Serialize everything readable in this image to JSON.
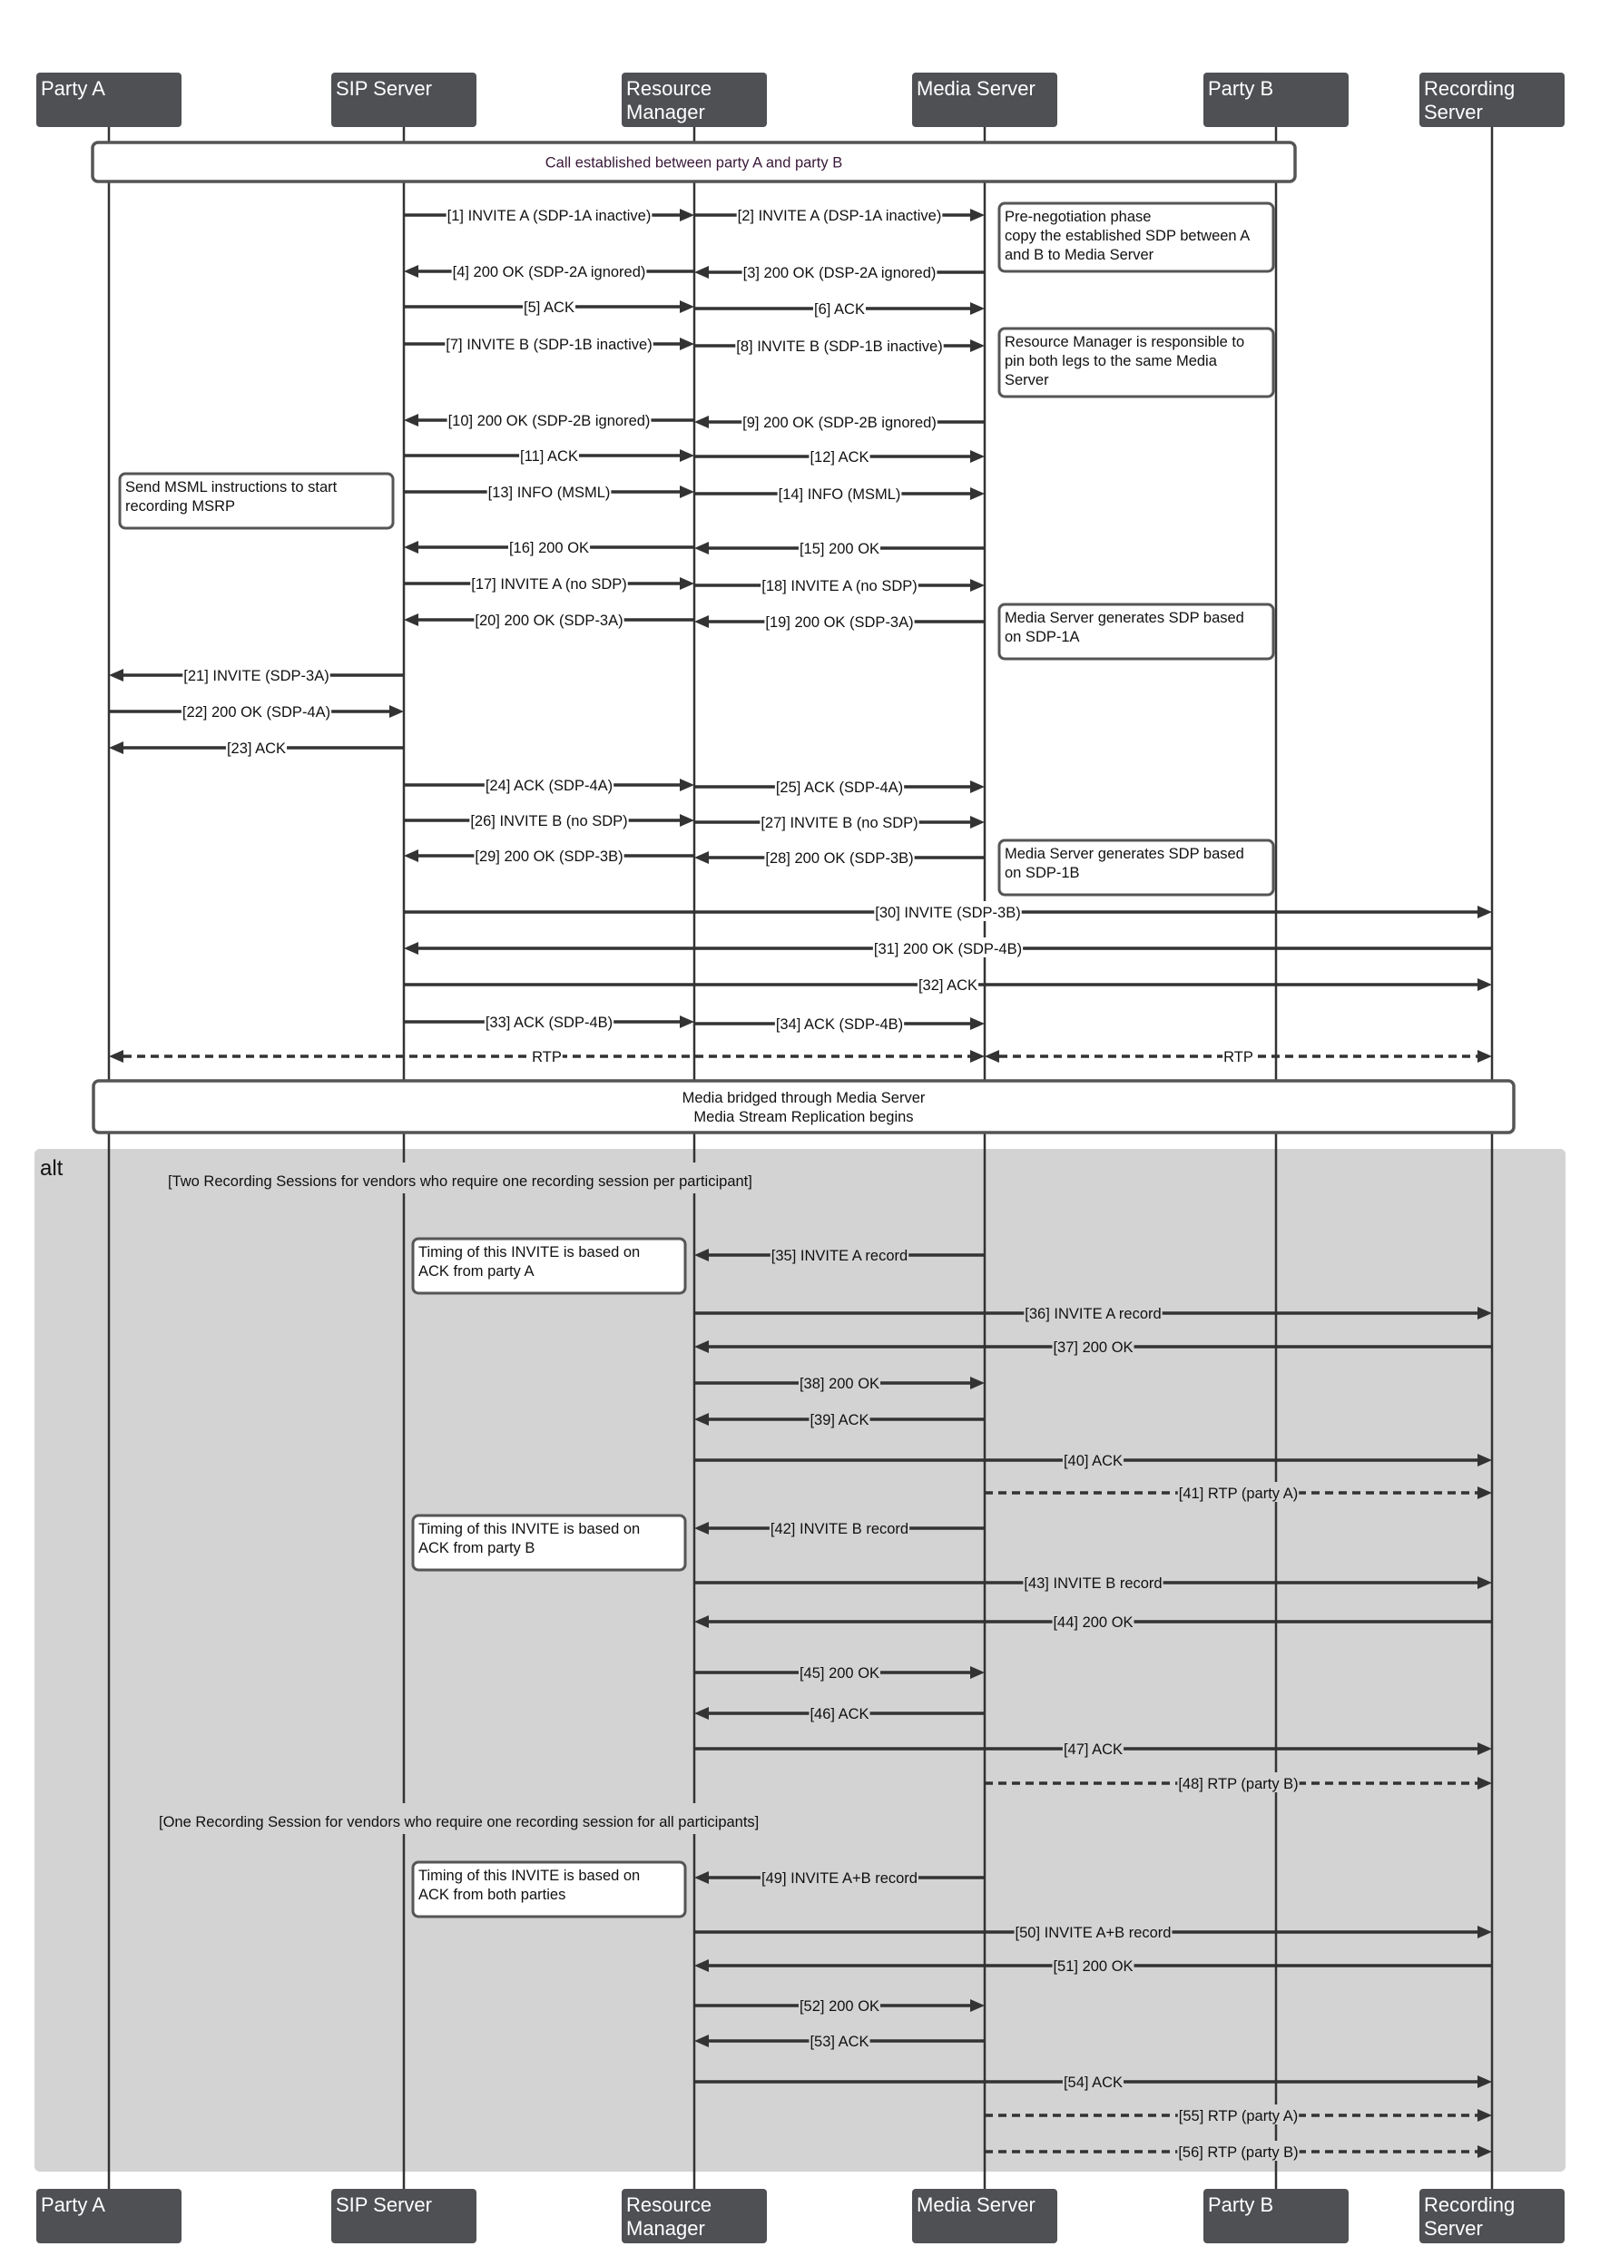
{
  "participants": [
    {
      "id": "party-a",
      "label_lines": [
        "Party A"
      ]
    },
    {
      "id": "sip-server",
      "label_lines": [
        "SIP Server"
      ]
    },
    {
      "id": "resource-manager",
      "label_lines": [
        "Resource",
        "Manager"
      ]
    },
    {
      "id": "media-server",
      "label_lines": [
        "Media Server"
      ]
    },
    {
      "id": "party-b",
      "label_lines": [
        "Party B"
      ]
    },
    {
      "id": "recording-server",
      "label_lines": [
        "Recording",
        "Server"
      ]
    }
  ],
  "bands": [
    {
      "id": "call-established",
      "lines": [
        "Call established between party A and party B"
      ],
      "from": "party-a",
      "to": "party-b",
      "color": "#3a1a3a"
    },
    {
      "id": "media-bridged",
      "lines": [
        "Media bridged through Media Server",
        "Media Stream Replication begins"
      ],
      "from": "party-a",
      "to": "recording-server",
      "color": "#111111"
    }
  ],
  "alt_fragment": {
    "label": "alt",
    "guards": [
      "[Two Recording Sessions for vendors who require one recording session per participant]",
      "[One Recording Session for vendors who require one recording session for all participants]"
    ]
  },
  "notes": [
    {
      "id": "note-pre-negotiation",
      "lines": [
        "Pre-negotiation phase",
        "copy the established SDP between A",
        "and B to Media Server"
      ]
    },
    {
      "id": "note-pin-legs",
      "lines": [
        "Resource Manager is responsible to",
        "pin both legs to the same Media",
        "Server"
      ]
    },
    {
      "id": "note-msml",
      "lines": [
        "Send MSML instructions to start",
        "recording MSRP"
      ]
    },
    {
      "id": "note-sdp-1a",
      "lines": [
        "Media Server generates SDP based",
        "on SDP-1A"
      ]
    },
    {
      "id": "note-sdp-1b",
      "lines": [
        "Media Server generates SDP based",
        "on SDP-1B"
      ]
    },
    {
      "id": "note-timing-a",
      "lines": [
        "Timing of this INVITE is based on",
        "ACK from party A"
      ]
    },
    {
      "id": "note-timing-b",
      "lines": [
        "Timing of this INVITE is based on",
        "ACK from party B"
      ]
    },
    {
      "id": "note-timing-ab",
      "lines": [
        "Timing of this INVITE is based on",
        "ACK from both parties"
      ]
    }
  ],
  "messages": [
    {
      "n": 1,
      "label": "[1] INVITE A (SDP-1A inactive)",
      "from": "sip-server",
      "to": "resource-manager",
      "style": "solid"
    },
    {
      "n": 2,
      "label": "[2] INVITE A (DSP-1A inactive)",
      "from": "resource-manager",
      "to": "media-server",
      "style": "solid"
    },
    {
      "n": 3,
      "label": "[3] 200 OK (DSP-2A ignored)",
      "from": "media-server",
      "to": "resource-manager",
      "style": "solid"
    },
    {
      "n": 4,
      "label": "[4] 200 OK (SDP-2A ignored)",
      "from": "resource-manager",
      "to": "sip-server",
      "style": "solid"
    },
    {
      "n": 5,
      "label": "[5] ACK",
      "from": "sip-server",
      "to": "resource-manager",
      "style": "solid"
    },
    {
      "n": 6,
      "label": "[6] ACK",
      "from": "resource-manager",
      "to": "media-server",
      "style": "solid"
    },
    {
      "n": 7,
      "label": "[7] INVITE B (SDP-1B inactive)",
      "from": "sip-server",
      "to": "resource-manager",
      "style": "solid"
    },
    {
      "n": 8,
      "label": "[8] INVITE B (SDP-1B inactive)",
      "from": "resource-manager",
      "to": "media-server",
      "style": "solid"
    },
    {
      "n": 9,
      "label": "[9] 200 OK (SDP-2B ignored)",
      "from": "media-server",
      "to": "resource-manager",
      "style": "solid"
    },
    {
      "n": 10,
      "label": "[10] 200 OK (SDP-2B ignored)",
      "from": "resource-manager",
      "to": "sip-server",
      "style": "solid"
    },
    {
      "n": 11,
      "label": "[11] ACK",
      "from": "sip-server",
      "to": "resource-manager",
      "style": "solid"
    },
    {
      "n": 12,
      "label": "[12] ACK",
      "from": "resource-manager",
      "to": "media-server",
      "style": "solid"
    },
    {
      "n": 13,
      "label": "[13] INFO (MSML)",
      "from": "sip-server",
      "to": "resource-manager",
      "style": "solid"
    },
    {
      "n": 14,
      "label": "[14] INFO (MSML)",
      "from": "resource-manager",
      "to": "media-server",
      "style": "solid"
    },
    {
      "n": 15,
      "label": "[15] 200 OK",
      "from": "media-server",
      "to": "resource-manager",
      "style": "solid"
    },
    {
      "n": 16,
      "label": "[16] 200 OK",
      "from": "resource-manager",
      "to": "sip-server",
      "style": "solid"
    },
    {
      "n": 17,
      "label": "[17] INVITE A (no SDP)",
      "from": "sip-server",
      "to": "resource-manager",
      "style": "solid"
    },
    {
      "n": 18,
      "label": "[18] INVITE A (no SDP)",
      "from": "resource-manager",
      "to": "media-server",
      "style": "solid"
    },
    {
      "n": 19,
      "label": "[19] 200 OK (SDP-3A)",
      "from": "media-server",
      "to": "resource-manager",
      "style": "solid"
    },
    {
      "n": 20,
      "label": "[20] 200 OK (SDP-3A)",
      "from": "resource-manager",
      "to": "sip-server",
      "style": "solid"
    },
    {
      "n": 21,
      "label": "[21] INVITE (SDP-3A)",
      "from": "sip-server",
      "to": "party-a",
      "style": "solid"
    },
    {
      "n": 22,
      "label": "[22] 200 OK (SDP-4A)",
      "from": "party-a",
      "to": "sip-server",
      "style": "solid"
    },
    {
      "n": 23,
      "label": "[23] ACK",
      "from": "sip-server",
      "to": "party-a",
      "style": "solid"
    },
    {
      "n": 24,
      "label": "[24] ACK (SDP-4A)",
      "from": "sip-server",
      "to": "resource-manager",
      "style": "solid"
    },
    {
      "n": 25,
      "label": "[25] ACK (SDP-4A)",
      "from": "resource-manager",
      "to": "media-server",
      "style": "solid"
    },
    {
      "n": 26,
      "label": "[26] INVITE B (no SDP)",
      "from": "sip-server",
      "to": "resource-manager",
      "style": "solid"
    },
    {
      "n": 27,
      "label": "[27] INVITE B (no SDP)",
      "from": "resource-manager",
      "to": "media-server",
      "style": "solid"
    },
    {
      "n": 28,
      "label": "[28] 200 OK (SDP-3B)",
      "from": "media-server",
      "to": "resource-manager",
      "style": "solid"
    },
    {
      "n": 29,
      "label": "[29] 200 OK (SDP-3B)",
      "from": "resource-manager",
      "to": "sip-server",
      "style": "solid"
    },
    {
      "n": 30,
      "label": "[30] INVITE (SDP-3B)",
      "from": "sip-server",
      "to": "recording-server",
      "style": "solid"
    },
    {
      "n": 31,
      "label": "[31] 200 OK (SDP-4B)",
      "from": "recording-server",
      "to": "sip-server",
      "style": "solid"
    },
    {
      "n": 32,
      "label": "[32] ACK",
      "from": "sip-server",
      "to": "recording-server",
      "style": "solid"
    },
    {
      "n": 33,
      "label": "[33] ACK (SDP-4B)",
      "from": "sip-server",
      "to": "resource-manager",
      "style": "solid"
    },
    {
      "n": 34,
      "label": "[34] ACK (SDP-4B)",
      "from": "resource-manager",
      "to": "media-server",
      "style": "solid"
    },
    {
      "n": "rtp-a",
      "label": "RTP",
      "from": "party-a",
      "to": "media-server",
      "style": "dashed",
      "bidirectional": true
    },
    {
      "n": "rtp-b",
      "label": "RTP",
      "from": "media-server",
      "to": "recording-server",
      "style": "dashed",
      "bidirectional": true
    },
    {
      "n": 35,
      "label": "[35] INVITE A record",
      "from": "media-server",
      "to": "resource-manager",
      "style": "solid"
    },
    {
      "n": 36,
      "label": "[36] INVITE A record",
      "from": "resource-manager",
      "to": "recording-server",
      "style": "solid"
    },
    {
      "n": 37,
      "label": "[37] 200 OK",
      "from": "recording-server",
      "to": "resource-manager",
      "style": "solid"
    },
    {
      "n": 38,
      "label": "[38] 200 OK",
      "from": "resource-manager",
      "to": "media-server",
      "style": "solid"
    },
    {
      "n": 39,
      "label": "[39] ACK",
      "from": "media-server",
      "to": "resource-manager",
      "style": "solid"
    },
    {
      "n": 40,
      "label": "[40] ACK",
      "from": "resource-manager",
      "to": "recording-server",
      "style": "solid"
    },
    {
      "n": 41,
      "label": "[41] RTP (party A)",
      "from": "media-server",
      "to": "recording-server",
      "style": "dashed"
    },
    {
      "n": 42,
      "label": "[42] INVITE B record",
      "from": "media-server",
      "to": "resource-manager",
      "style": "solid"
    },
    {
      "n": 43,
      "label": "[43] INVITE B record",
      "from": "resource-manager",
      "to": "recording-server",
      "style": "solid"
    },
    {
      "n": 44,
      "label": "[44] 200 OK",
      "from": "recording-server",
      "to": "resource-manager",
      "style": "solid"
    },
    {
      "n": 45,
      "label": "[45] 200 OK",
      "from": "resource-manager",
      "to": "media-server",
      "style": "solid"
    },
    {
      "n": 46,
      "label": "[46] ACK",
      "from": "media-server",
      "to": "resource-manager",
      "style": "solid"
    },
    {
      "n": 47,
      "label": "[47] ACK",
      "from": "resource-manager",
      "to": "recording-server",
      "style": "solid"
    },
    {
      "n": 48,
      "label": "[48] RTP (party B)",
      "from": "media-server",
      "to": "recording-server",
      "style": "dashed"
    },
    {
      "n": 49,
      "label": "[49] INVITE A+B record",
      "from": "media-server",
      "to": "resource-manager",
      "style": "solid"
    },
    {
      "n": 50,
      "label": "[50] INVITE A+B record",
      "from": "resource-manager",
      "to": "recording-server",
      "style": "solid"
    },
    {
      "n": 51,
      "label": "[51] 200 OK",
      "from": "recording-server",
      "to": "resource-manager",
      "style": "solid"
    },
    {
      "n": 52,
      "label": "[52] 200 OK",
      "from": "resource-manager",
      "to": "media-server",
      "style": "solid"
    },
    {
      "n": 53,
      "label": "[53] ACK",
      "from": "media-server",
      "to": "resource-manager",
      "style": "solid"
    },
    {
      "n": 54,
      "label": "[54] ACK",
      "from": "resource-manager",
      "to": "recording-server",
      "style": "solid"
    },
    {
      "n": 55,
      "label": "[55] RTP (party A)",
      "from": "media-server",
      "to": "recording-server",
      "style": "dashed"
    },
    {
      "n": 56,
      "label": "[56] RTP (party B)",
      "from": "media-server",
      "to": "recording-server",
      "style": "dashed"
    }
  ]
}
